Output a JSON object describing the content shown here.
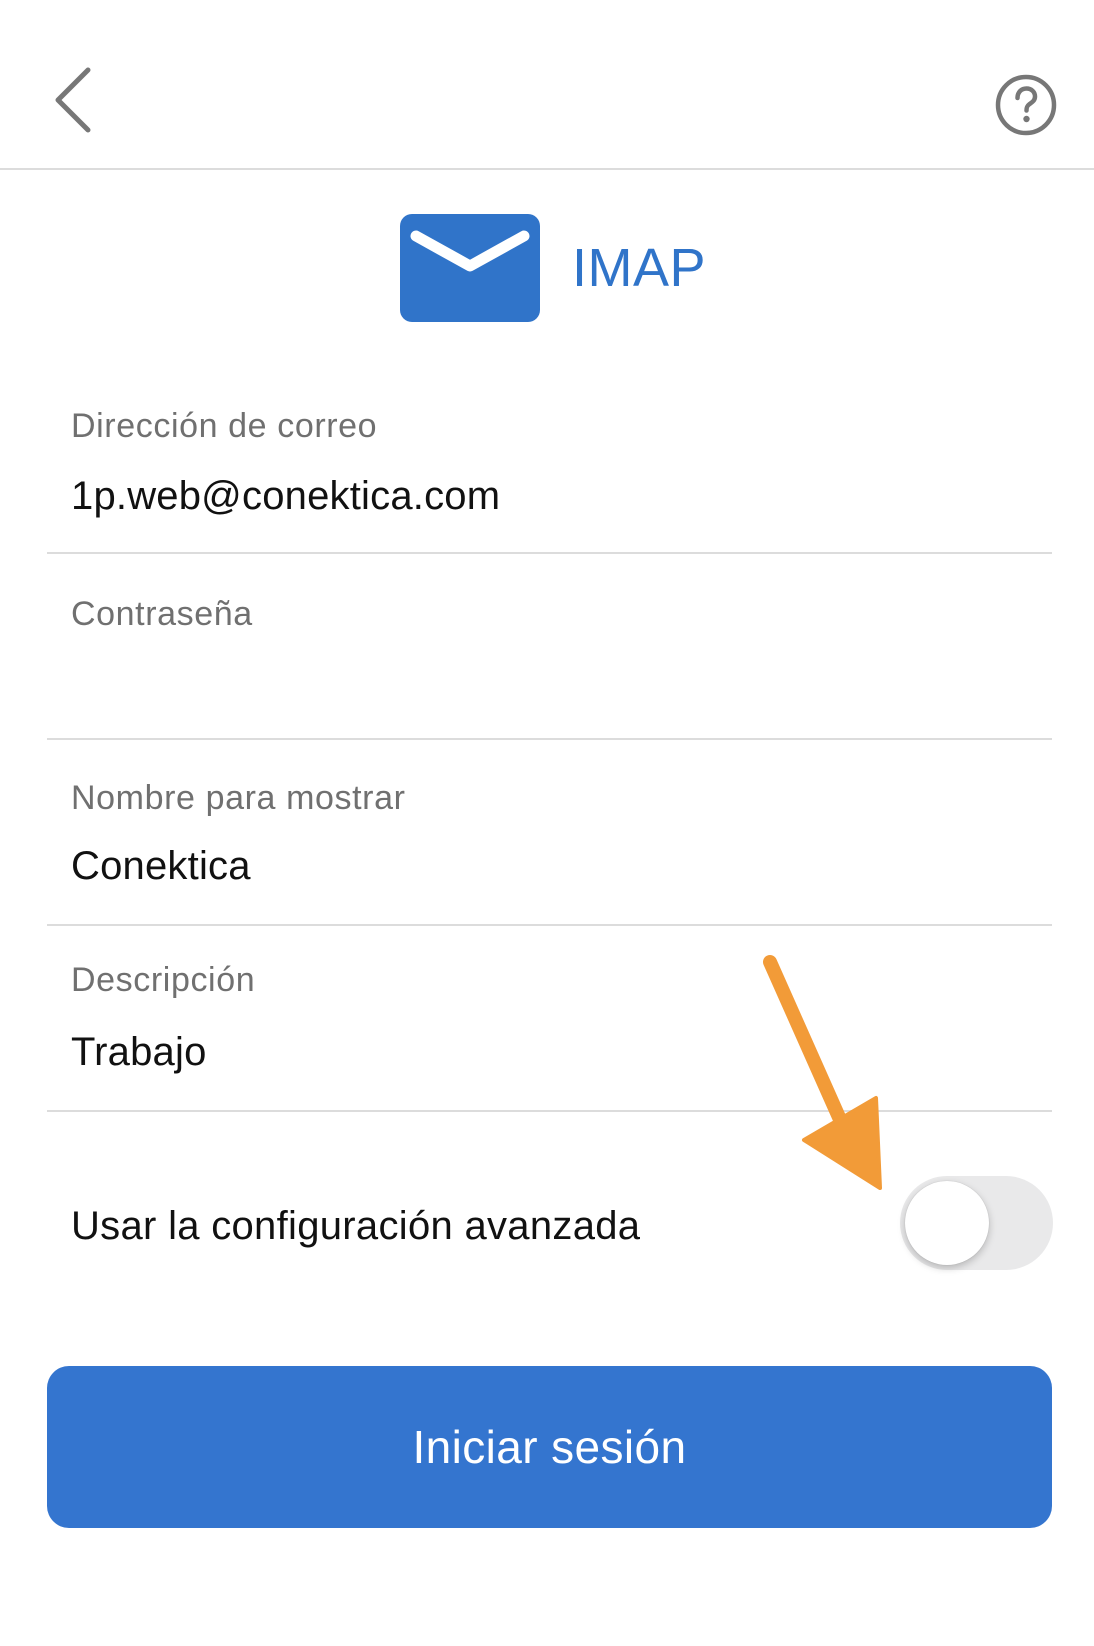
{
  "nav": {
    "back_icon": "chevron-left-icon",
    "help_icon": "question-circle-icon"
  },
  "header": {
    "icon": "mail-envelope-icon",
    "title": "IMAP",
    "accent_color": "#3074c9"
  },
  "form": {
    "email": {
      "label": "Dirección de correo",
      "value": "1p.web@conektica.com"
    },
    "password": {
      "label": "Contraseña",
      "value": ""
    },
    "display_name": {
      "label": "Nombre para mostrar",
      "value": "Conektica"
    },
    "description": {
      "label": "Descripción",
      "value": "Trabajo"
    }
  },
  "advanced": {
    "label": "Usar la configuración avanzada",
    "enabled": false
  },
  "annotation": {
    "arrow_color": "#f29b38",
    "target": "advanced-settings-toggle"
  },
  "actions": {
    "sign_in_label": "Iniciar sesión",
    "sign_in_color": "#3475cf"
  }
}
